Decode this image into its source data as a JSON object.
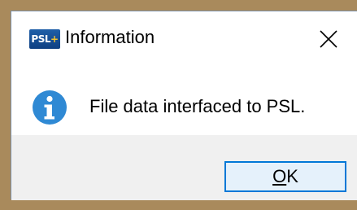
{
  "window": {
    "title": "Information",
    "app_icon_text": "PSL",
    "app_icon_plus": "+"
  },
  "message": {
    "icon": "information-icon",
    "text": "File data interfaced to PSL."
  },
  "buttons": {
    "ok_label_mnemonic": "O",
    "ok_label_rest": "K"
  },
  "colors": {
    "accent": "#0078d7",
    "info_icon": "#2f89d4",
    "frame": "#a98a5c",
    "button_bar": "#f0f0f0"
  }
}
